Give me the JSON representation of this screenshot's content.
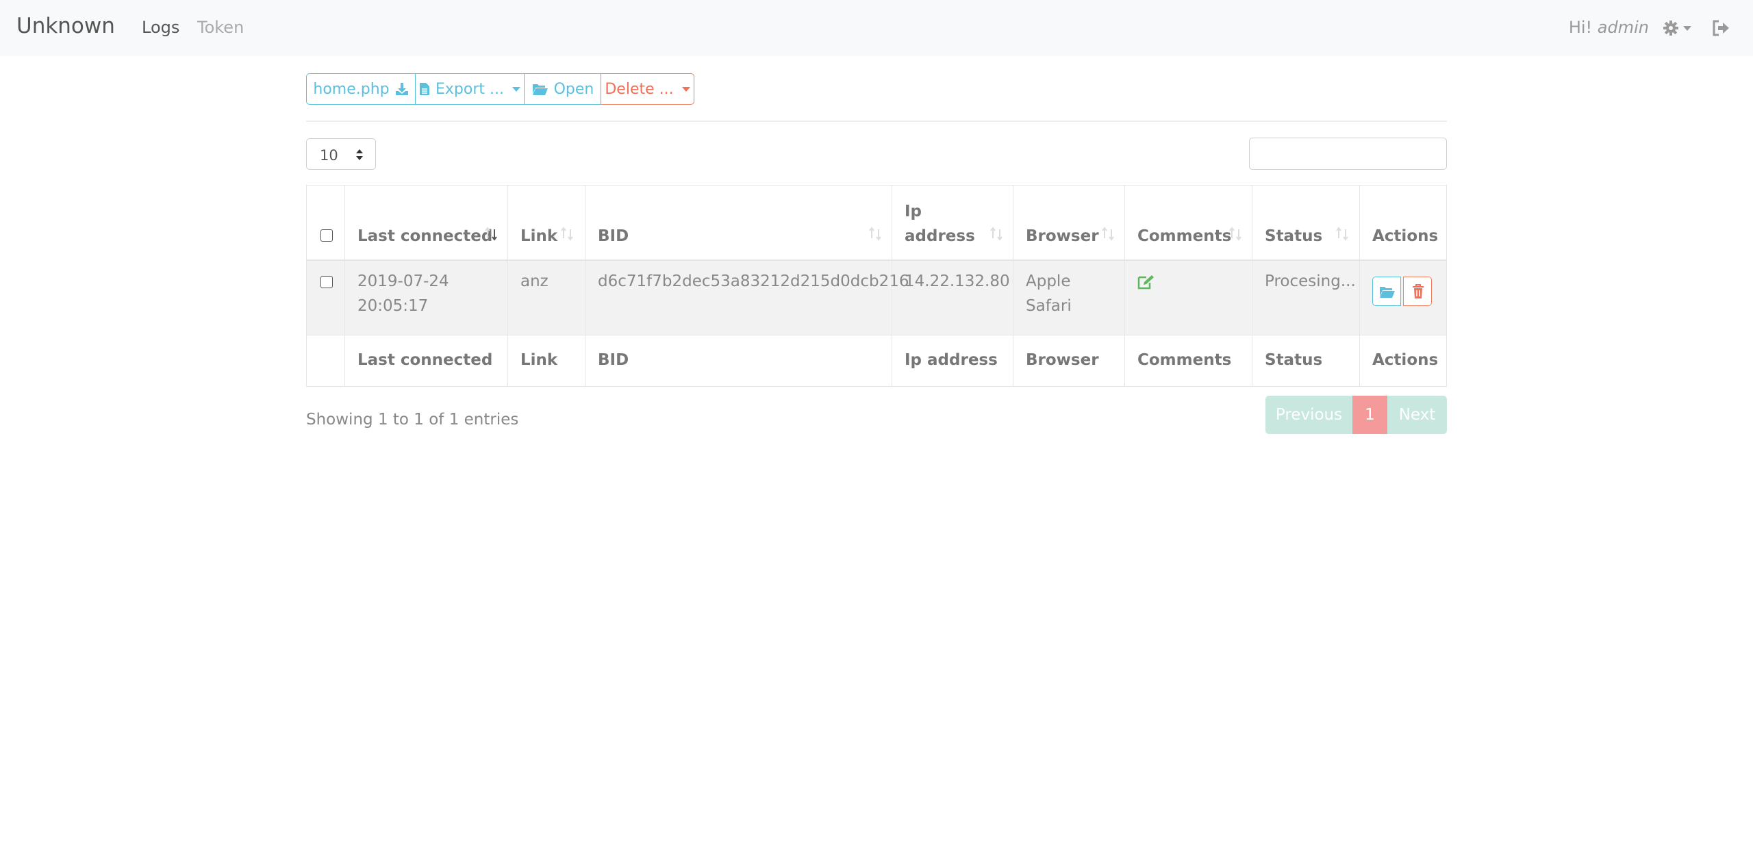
{
  "navbar": {
    "brand": "Unknown",
    "links": [
      "Logs",
      "Token"
    ],
    "greeting_prefix": "Hi!",
    "username": "admin"
  },
  "toolbar": {
    "home_label": "home.php",
    "export_label": "Export ...",
    "open_label": "Open",
    "delete_label": "Delete ..."
  },
  "table_controls": {
    "page_length": "10",
    "search_value": ""
  },
  "table": {
    "header": {
      "last_connected": "Last connected",
      "link": "Link",
      "bid": "BID",
      "ip_line1": "Ip",
      "ip_line2": "address",
      "browser": "Browser",
      "comments": "Comments",
      "status": "Status",
      "actions": "Actions"
    },
    "rows": [
      {
        "date": "2019-07-24",
        "time": "20:05:17",
        "link": "anz",
        "bid": "d6c71f7b2dec53a83212d215d0dcb216",
        "ip": "14.22.132.80",
        "browser_line1": "Apple",
        "browser_line2": "Safari",
        "status": "Procesing..."
      }
    ],
    "footer": {
      "last_connected": "Last connected",
      "link": "Link",
      "bid": "BID",
      "ip": "Ip address",
      "browser": "Browser",
      "comments": "Comments",
      "status": "Status",
      "actions": "Actions"
    }
  },
  "info": "Showing 1 to 1 of 1 entries",
  "pagination": {
    "previous": "Previous",
    "current": "1",
    "next": "Next"
  },
  "colors": {
    "info": "#5bc0de",
    "danger": "#f0705a",
    "success": "#5cb85c",
    "page_active": "#f59a9a",
    "page_disabled": "#c8e8df"
  },
  "icons": [
    "download-icon",
    "file-icon",
    "folder-open-icon",
    "caret-down-icon",
    "gear-icon",
    "sign-out-icon",
    "sort-icon",
    "edit-icon",
    "trash-icon"
  ]
}
